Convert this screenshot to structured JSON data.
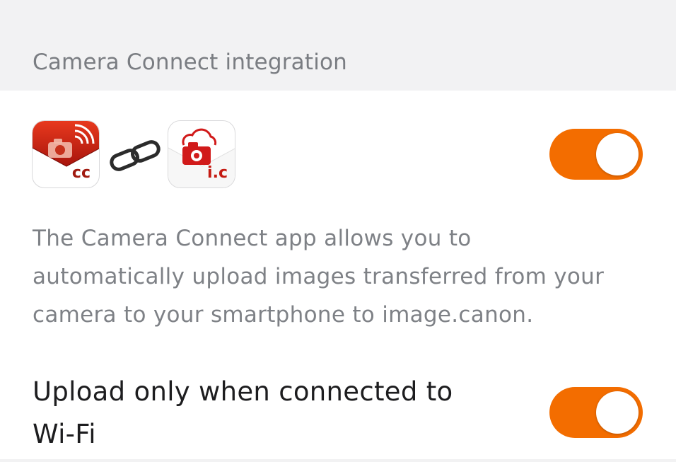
{
  "section": {
    "title": "Camera Connect integration"
  },
  "apps": {
    "camera_connect_icon": "camera-connect-app-icon",
    "camera_connect_badge": "cc",
    "link_icon": "chain-link-icon",
    "image_canon_icon": "image-canon-app-icon",
    "image_canon_badge": "i.c"
  },
  "integration_toggle": {
    "state": "on"
  },
  "description": {
    "lines": [
      "The Camera Connect app allows you to",
      "automatically upload images transferred from your",
      "camera to your smartphone to image.canon."
    ]
  },
  "wifi_setting": {
    "label_lines": [
      "Upload only when connected to",
      "Wi-Fi"
    ],
    "toggle_state": "on"
  },
  "colors": {
    "accent": "#f36d00",
    "brand_red": "#d11a1a",
    "header_bg": "#f2f2f3"
  }
}
